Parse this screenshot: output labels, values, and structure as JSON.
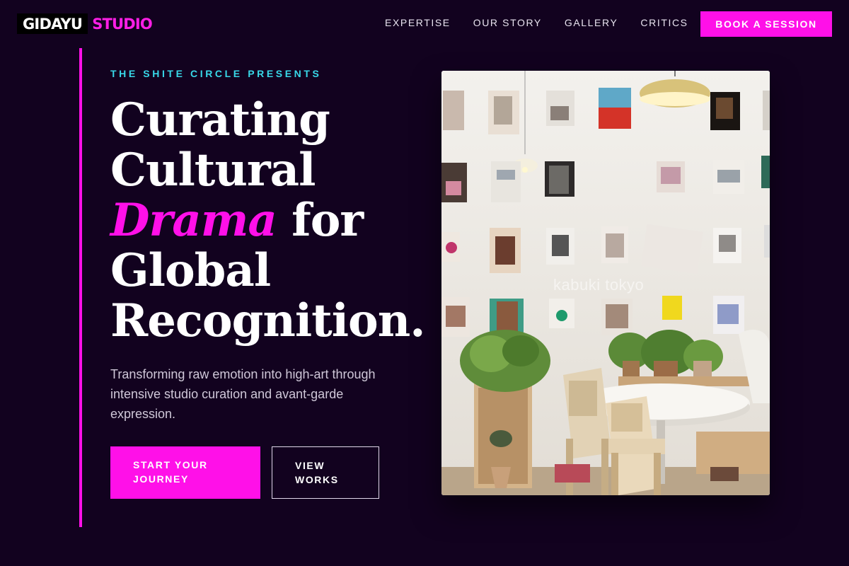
{
  "brand": {
    "name": "GIDAYU",
    "accent": "STUDIO",
    "accent_color": "#ff10e8",
    "background_color": "#12021f",
    "eyebrow_color": "#38d8e8"
  },
  "nav": {
    "items": [
      "EXPERTISE",
      "OUR STORY",
      "GALLERY",
      "CRITICS"
    ],
    "cta": "BOOK A SESSION"
  },
  "hero": {
    "eyebrow": "THE SHITE CIRCLE PRESENTS",
    "headline": {
      "line1": "Curating",
      "line2": "Cultural",
      "accent": "Drama",
      "line3_rest": " for",
      "line4": "Global",
      "line5": "Recognition."
    },
    "subtext": "Transforming raw emotion into high-art through intensive studio curation and avant-garde expression.",
    "primary_button": "START YOUR JOURNEY",
    "secondary_button": "VIEW WORKS",
    "image": {
      "subject": "bright cafe interior with magazines clipped on a white wall, pendant lamp, round table, wooden chairs and potted plants",
      "watermark": "kabuki tokyo"
    }
  }
}
